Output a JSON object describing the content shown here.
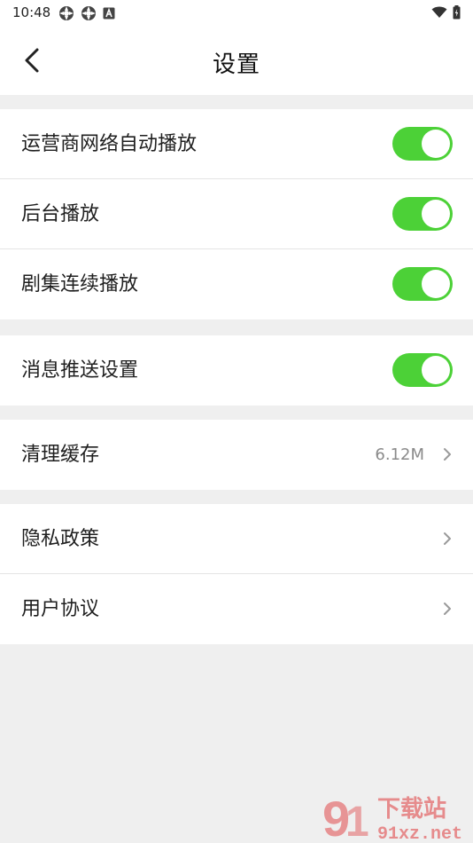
{
  "status_bar": {
    "time": "10:48"
  },
  "header": {
    "title": "设置"
  },
  "groups": [
    {
      "rows": [
        {
          "label": "运营商网络自动播放",
          "toggle": true
        },
        {
          "label": "后台播放",
          "toggle": true
        },
        {
          "label": "剧集连续播放",
          "toggle": true
        }
      ]
    },
    {
      "rows": [
        {
          "label": "消息推送设置",
          "toggle": true
        }
      ]
    },
    {
      "rows": [
        {
          "label": "清理缓存",
          "value": "6.12M"
        }
      ]
    },
    {
      "rows": [
        {
          "label": "隐私政策"
        },
        {
          "label": "用户协议"
        }
      ]
    }
  ],
  "watermark": {
    "brand": "下载站",
    "site": "91xz.net"
  },
  "colors": {
    "toggle_on": "#4cd137",
    "page_background": "#efefef",
    "watermark": "#e0484a"
  }
}
